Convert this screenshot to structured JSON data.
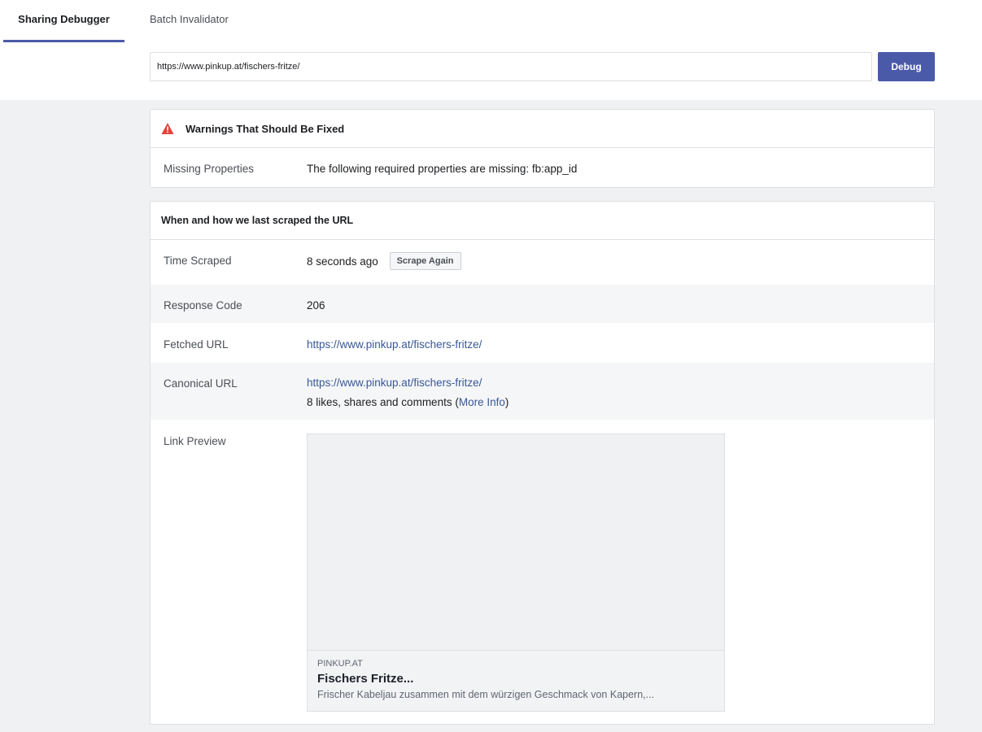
{
  "tabs": {
    "active": "Sharing Debugger",
    "inactive": "Batch Invalidator"
  },
  "search": {
    "value": "https://www.pinkup.at/fischers-fritze/",
    "debug_label": "Debug"
  },
  "warnings": {
    "title": "Warnings That Should Be Fixed",
    "row_key": "Missing Properties",
    "row_value": "The following required properties are missing: fb:app_id"
  },
  "scrape": {
    "title": "When and how we last scraped the URL",
    "time_key": "Time Scraped",
    "time_value": "8 seconds ago",
    "scrape_again_label": "Scrape Again",
    "response_key": "Response Code",
    "response_value": "206",
    "fetched_key": "Fetched URL",
    "fetched_value": "https://www.pinkup.at/fischers-fritze/",
    "canonical_key": "Canonical URL",
    "canonical_value": "https://www.pinkup.at/fischers-fritze/",
    "engagement_text": "8 likes, shares and comments (",
    "more_info_label": "More Info",
    "engagement_close": ")",
    "preview_key": "Link Preview"
  },
  "preview": {
    "domain": "PINKUP.AT",
    "title": "Fischers Fritze...",
    "description": "Frischer Kabeljau zusammen mit dem würzigen Geschmack von Kapern,..."
  },
  "colors": {
    "accent": "#4b5aa8",
    "link": "#385898",
    "warning": "#e4433a"
  }
}
